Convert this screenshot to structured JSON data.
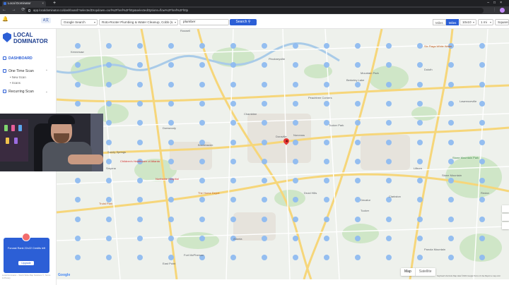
{
  "browser": {
    "tab_title": "Local Dominator",
    "new_tab": "+",
    "url": "app.localdominator.co/dashboard?selectedDropdown=curl%2Fhref%2Fhttp&selectedOptions=flow%2Fhref%2Fhttp"
  },
  "header": {
    "lang_label": "A文",
    "search_type": "Google Search",
    "business": "Roto-Rooter Plumbing & Water Cleanup, Cobb (s.",
    "keyword": "plumber",
    "search_button": "Search",
    "units": [
      "Miles",
      "Miles"
    ],
    "grid": "10x10",
    "radius": "1 mi",
    "shape": "Square"
  },
  "sidebar": {
    "brand_line1": "LOCAL",
    "brand_line2": "DOMINATOR",
    "items": [
      {
        "label": "DASHBOARD"
      },
      {
        "label": "One Time Scan"
      },
      {
        "label": "New Scan"
      },
      {
        "label": "Scans"
      },
      {
        "label": "Recurring Scan"
      }
    ],
    "promo_text": "Forcast Rank 22x22 Credits left",
    "promo_button": "Upgrade",
    "footer": "Local Dominator – World Wide Map Solutions ©, Terms & Privacy"
  },
  "map": {
    "labels": [
      {
        "text": "Atlanta",
        "kind": "city"
      },
      {
        "text": "Roswell",
        "kind": "city"
      },
      {
        "text": "Dunwoody",
        "kind": "city"
      },
      {
        "text": "Doraville",
        "kind": "city"
      },
      {
        "text": "Tucker",
        "kind": "city"
      },
      {
        "text": "Smyrna",
        "kind": "city"
      },
      {
        "text": "Norcross",
        "kind": "city"
      },
      {
        "text": "Chamblee",
        "kind": "city"
      },
      {
        "text": "Sandy Springs",
        "kind": "city"
      },
      {
        "text": "Druid Hills",
        "kind": "city"
      },
      {
        "text": "Decatur",
        "kind": "city"
      },
      {
        "text": "Brookhaven",
        "kind": "city"
      },
      {
        "text": "Lilburn",
        "kind": "city"
      },
      {
        "text": "Mountain Park",
        "kind": "city"
      },
      {
        "text": "Stone Mountain",
        "kind": "city"
      },
      {
        "text": "Peachtree Corners",
        "kind": "city"
      },
      {
        "text": "Berkeley Lake",
        "kind": "city"
      },
      {
        "text": "Duluth",
        "kind": "city"
      },
      {
        "text": "Lawrenceville",
        "kind": "city"
      },
      {
        "text": "Clarkston",
        "kind": "city"
      },
      {
        "text": "Tucker Park",
        "kind": "city"
      },
      {
        "text": "Pinckneyville",
        "kind": "city"
      },
      {
        "text": "Redan",
        "kind": "city"
      },
      {
        "text": "Kennesaw",
        "kind": "city"
      },
      {
        "text": "East Point",
        "kind": "city"
      },
      {
        "text": "Panola Mountain",
        "kind": "city"
      },
      {
        "text": "Fort McPherson",
        "kind": "city"
      },
      {
        "text": "The Home Depot",
        "kind": "poi"
      },
      {
        "text": "Six Flags White Water",
        "kind": "poi"
      },
      {
        "text": "Stone Mountain Park",
        "kind": "park"
      },
      {
        "text": "Children's Healthcare of Atlanta",
        "kind": "hosp"
      },
      {
        "text": "Northside Hospital",
        "kind": "hosp"
      },
      {
        "text": "Truist Park",
        "kind": "poi"
      }
    ],
    "map_types": [
      "Map",
      "Satellite"
    ],
    "google": "Google",
    "attribution": "Keyboard shortcuts  Map data ©2024 Google  Terms of Use  Report a map error"
  },
  "colors": {
    "accent": "#2c5fd6",
    "grid_point": "#8ebbf0",
    "pin": "#e53935"
  }
}
